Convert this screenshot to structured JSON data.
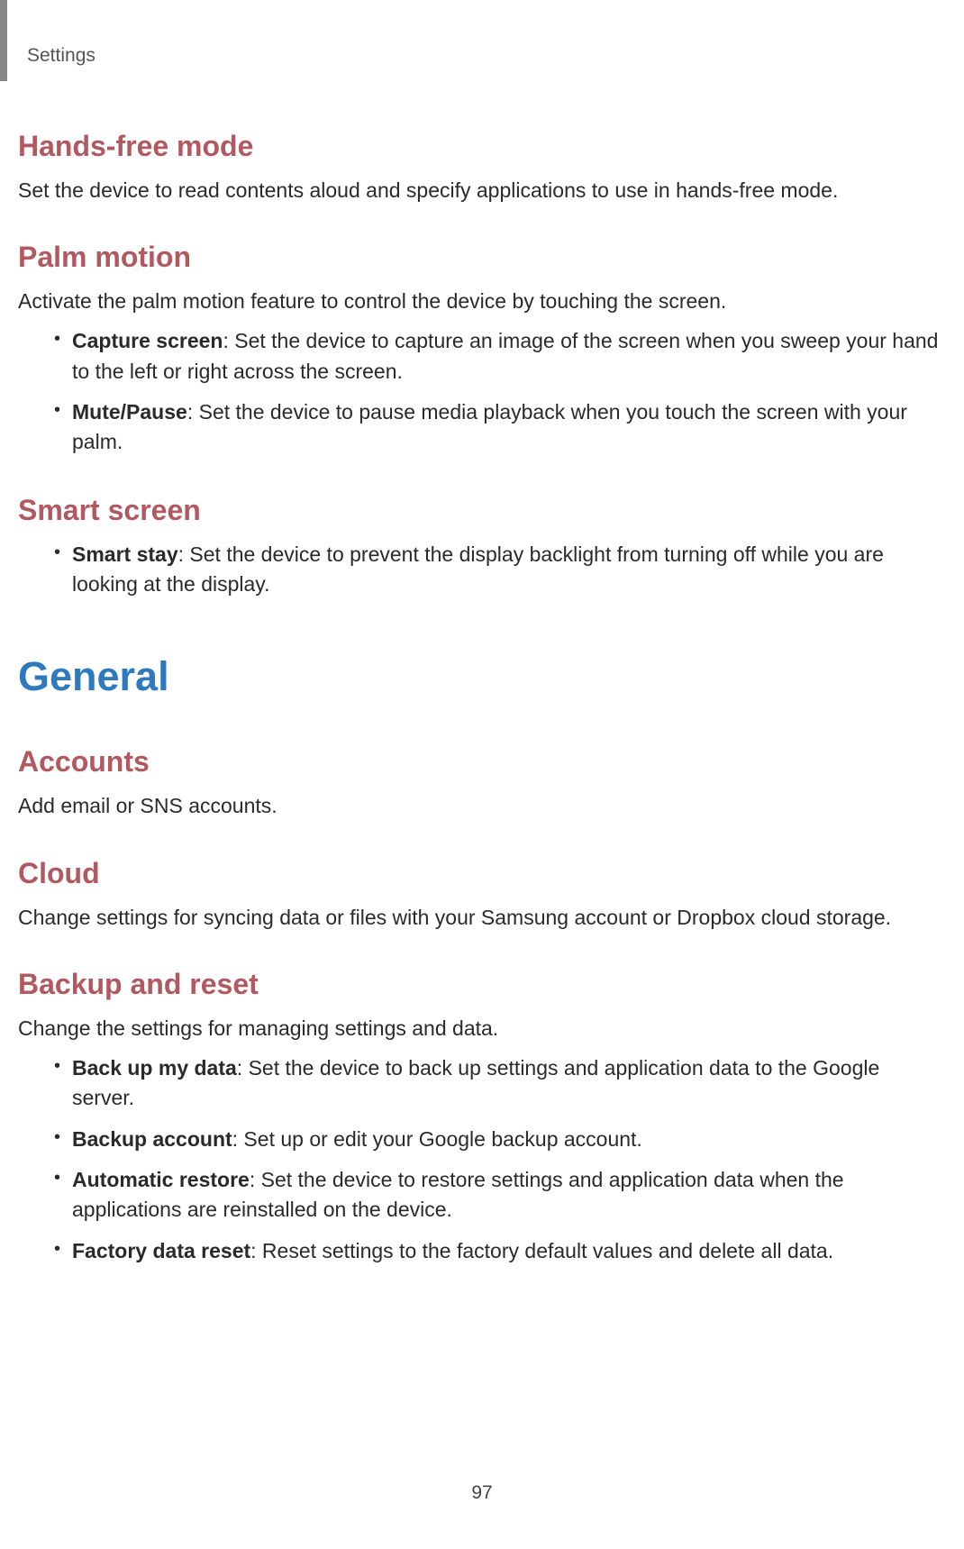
{
  "header": {
    "label": "Settings"
  },
  "sections": {
    "handsfree": {
      "title": "Hands-free mode",
      "desc": "Set the device to read contents aloud and specify applications to use in hands-free mode."
    },
    "palm": {
      "title": "Palm motion",
      "desc": "Activate the palm motion feature to control the device by touching the screen.",
      "items": [
        {
          "term": "Capture screen",
          "text": ": Set the device to capture an image of the screen when you sweep your hand to the left or right across the screen."
        },
        {
          "term": "Mute/Pause",
          "text": ": Set the device to pause media playback when you touch the screen with your palm."
        }
      ]
    },
    "smart": {
      "title": "Smart screen",
      "items": [
        {
          "term": "Smart stay",
          "text": ": Set the device to prevent the display backlight from turning off while you are looking at the display."
        }
      ]
    },
    "general": {
      "title": "General"
    },
    "accounts": {
      "title": "Accounts",
      "desc": "Add email or SNS accounts."
    },
    "cloud": {
      "title": "Cloud",
      "desc": "Change settings for syncing data or files with your Samsung account or Dropbox cloud storage."
    },
    "backup": {
      "title": "Backup and reset",
      "desc": "Change the settings for managing settings and data.",
      "items": [
        {
          "term": "Back up my data",
          "text": ": Set the device to back up settings and application data to the Google server."
        },
        {
          "term": "Backup account",
          "text": ": Set up or edit your Google backup account."
        },
        {
          "term": "Automatic restore",
          "text": ": Set the device to restore settings and application data when the applications are reinstalled on the device."
        },
        {
          "term": "Factory data reset",
          "text": ": Reset settings to the factory default values and delete all data."
        }
      ]
    }
  },
  "page_number": "97"
}
